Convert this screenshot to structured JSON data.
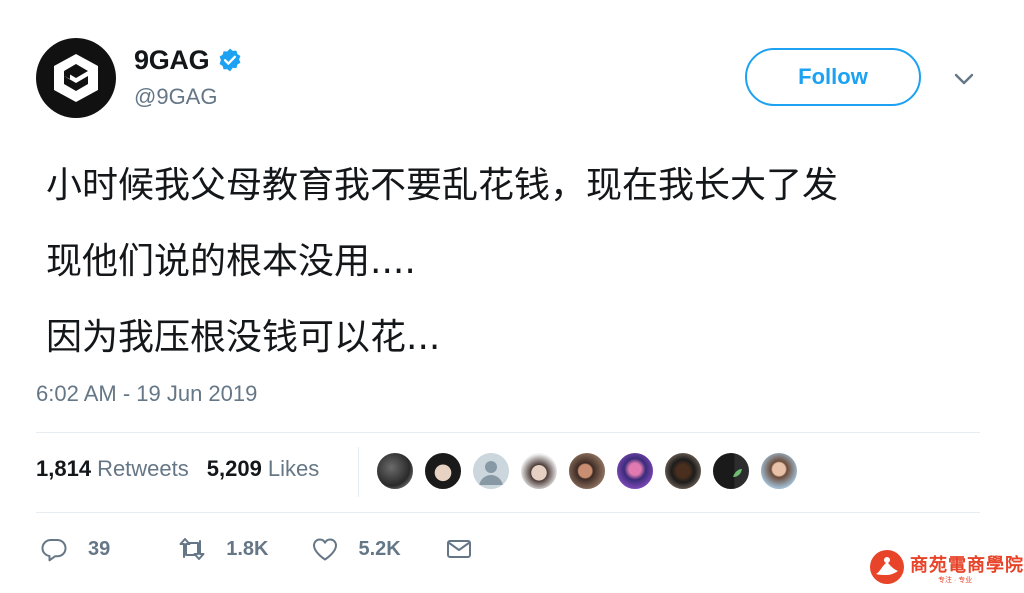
{
  "author": {
    "display_name": "9GAG",
    "handle": "@9GAG",
    "verified": true,
    "avatar_icon": "9gag-logo"
  },
  "follow_label": "Follow",
  "tweet_lines": [
    "小时候我父母教育我不要乱花钱，现在我长大了发",
    "现他们说的根本没用....",
    "因为我压根没钱可以花..."
  ],
  "timestamp": "6:02 AM - 19 Jun 2019",
  "stats": {
    "retweets_count": "1,814",
    "retweets_label": "Retweets",
    "likes_count": "5,209",
    "likes_label": "Likes"
  },
  "actions": {
    "reply_count": "39",
    "retweet_count": "1.8K",
    "like_count": "5.2K"
  },
  "watermark": {
    "main_text": "商苑電商學院",
    "sub_text": "专注 · 专业"
  },
  "colors": {
    "accent": "#1da1f2",
    "secondary_text": "#657786",
    "watermark": "#e8442a"
  }
}
